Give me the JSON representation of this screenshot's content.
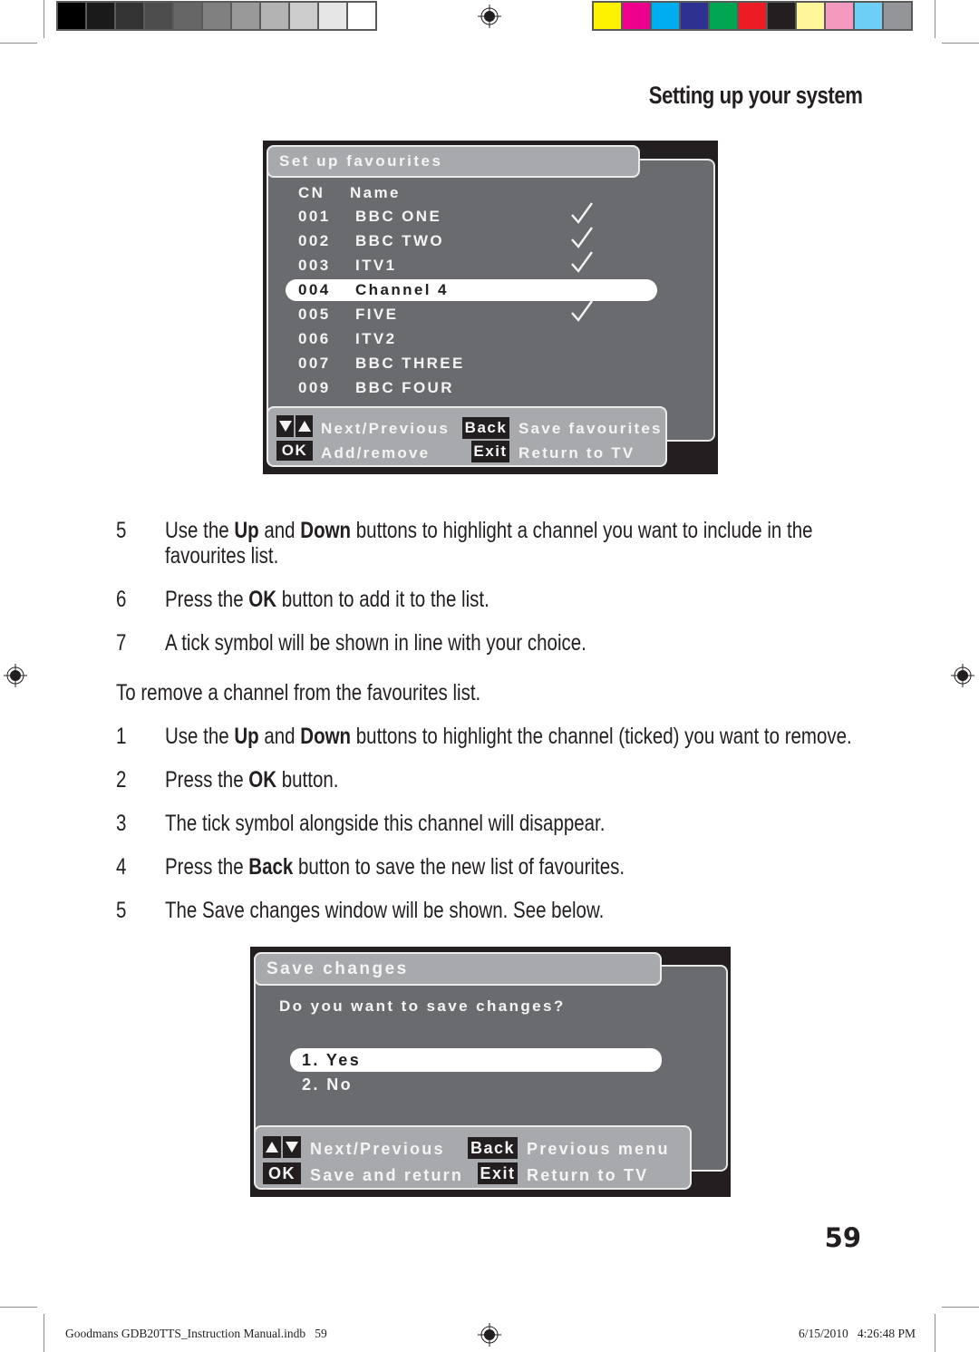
{
  "printer_marks": {
    "gray_swatches": [
      "#000000",
      "#1a1a1a",
      "#333333",
      "#4d4d4d",
      "#666666",
      "#808080",
      "#999999",
      "#b3b3b3",
      "#cccccc",
      "#e6e6e6",
      "#ffffff"
    ],
    "color_swatches": [
      "#fff200",
      "#ec008c",
      "#00aeef",
      "#2e3192",
      "#00a651",
      "#ed1c24",
      "#231f20",
      "#fff799",
      "#f49ac1",
      "#6dcff6",
      "#939598"
    ]
  },
  "header": {
    "section_title": "Setting up your system"
  },
  "favourites_screen": {
    "title": "Set up favourites",
    "columns": {
      "cn": "CN",
      "name": "Name"
    },
    "channels": [
      {
        "cn": "001",
        "name": "BBC ONE",
        "ticked": true,
        "highlighted": false
      },
      {
        "cn": "002",
        "name": "BBC TWO",
        "ticked": true,
        "highlighted": false
      },
      {
        "cn": "003",
        "name": "ITV1",
        "ticked": true,
        "highlighted": false
      },
      {
        "cn": "004",
        "name": "Channel 4",
        "ticked": false,
        "highlighted": true
      },
      {
        "cn": "005",
        "name": "FIVE",
        "ticked": true,
        "highlighted": false
      },
      {
        "cn": "006",
        "name": "ITV2",
        "ticked": false,
        "highlighted": false
      },
      {
        "cn": "007",
        "name": "BBC THREE",
        "ticked": false,
        "highlighted": false
      },
      {
        "cn": "009",
        "name": "BBC FOUR",
        "ticked": false,
        "highlighted": false
      }
    ],
    "footer": {
      "nav_label": "Next/Previous",
      "back_key": "Back",
      "back_label": "Save favourites",
      "ok_key": "OK",
      "ok_label": "Add/remove",
      "exit_key": "Exit",
      "exit_label": "Return to TV"
    }
  },
  "instructions_add": [
    {
      "num": "5",
      "parts": [
        [
          "Use the ",
          false
        ],
        [
          "Up",
          true
        ],
        [
          " and ",
          false
        ],
        [
          "Down",
          true
        ],
        [
          " buttons to highlight a channel you want to include in the",
          false
        ]
      ],
      "line2": "favourites list."
    },
    {
      "num": "6",
      "parts": [
        [
          "Press the ",
          false
        ],
        [
          "OK",
          true
        ],
        [
          " button to add it to the list.",
          false
        ]
      ]
    },
    {
      "num": "7",
      "parts": [
        [
          "A tick symbol will be shown in line with your choice.",
          false
        ]
      ]
    }
  ],
  "remove_intro": "To remove a channel from the favourites list.",
  "instructions_remove": [
    {
      "num": "1",
      "parts": [
        [
          "Use the ",
          false
        ],
        [
          "Up",
          true
        ],
        [
          " and ",
          false
        ],
        [
          "Down",
          true
        ],
        [
          " buttons to highlight the channel (ticked) you want to remove.",
          false
        ]
      ]
    },
    {
      "num": "2",
      "parts": [
        [
          "Press the ",
          false
        ],
        [
          "OK",
          true
        ],
        [
          " button.",
          false
        ]
      ]
    },
    {
      "num": "3",
      "parts": [
        [
          "The tick symbol alongside this channel will disappear.",
          false
        ]
      ]
    },
    {
      "num": "4",
      "parts": [
        [
          "Press the ",
          false
        ],
        [
          "Back",
          true
        ],
        [
          " button to save the new list of favourites.",
          false
        ]
      ]
    },
    {
      "num": "5",
      "parts": [
        [
          "The Save changes window will be shown. See below.",
          false
        ]
      ]
    }
  ],
  "save_screen": {
    "title": "Save changes",
    "question": "Do you want to save changes?",
    "options": [
      {
        "label": "1. Yes",
        "highlighted": true
      },
      {
        "label": "2. No",
        "highlighted": false
      }
    ],
    "footer": {
      "nav_label": "Next/Previous",
      "back_key": "Back",
      "back_label": "Previous menu",
      "ok_key": "OK",
      "ok_label": "Save and return",
      "exit_key": "Exit",
      "exit_label": "Return to TV"
    }
  },
  "page_number": "59",
  "slug": {
    "file": "Goodmans GDB20TTS_Instruction Manual.indb   59",
    "timestamp": "6/15/2010   4:26:48 PM"
  }
}
